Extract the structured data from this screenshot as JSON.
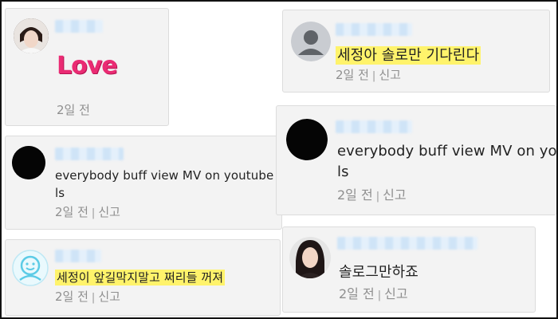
{
  "comments": [
    {
      "id": "c1",
      "text": "",
      "sticker": "Love",
      "time": "2일 전",
      "report": ""
    },
    {
      "id": "c2",
      "text_line1": "everybody buff view MV on youtube p",
      "text_line2": "ls",
      "time": "2일 전",
      "report": "신고"
    },
    {
      "id": "c3",
      "text": "세정이 앞길막지말고 쩌리들 꺼져",
      "time": "2일 전",
      "report": "신고"
    },
    {
      "id": "c4",
      "text": "세정아 솔로만 기다린다",
      "time": "2일 전",
      "report": "신고"
    },
    {
      "id": "c5",
      "text_line1": "everybody buff view MV on youtube",
      "text_line2": "ls",
      "time": "2일 전",
      "report": "신고"
    },
    {
      "id": "c6",
      "text": "솔로그만하죠",
      "time": "2일 전",
      "report": "신고"
    }
  ],
  "colors": {
    "highlight": "#fff36b",
    "sticker": "#ea2b73",
    "meta": "#8f8f8f",
    "card_bg": "#f3f3f3"
  },
  "icons": {
    "default_avatar": "person-silhouette-icon",
    "smile_avatar": "smiley-face-icon",
    "separator": "|"
  }
}
